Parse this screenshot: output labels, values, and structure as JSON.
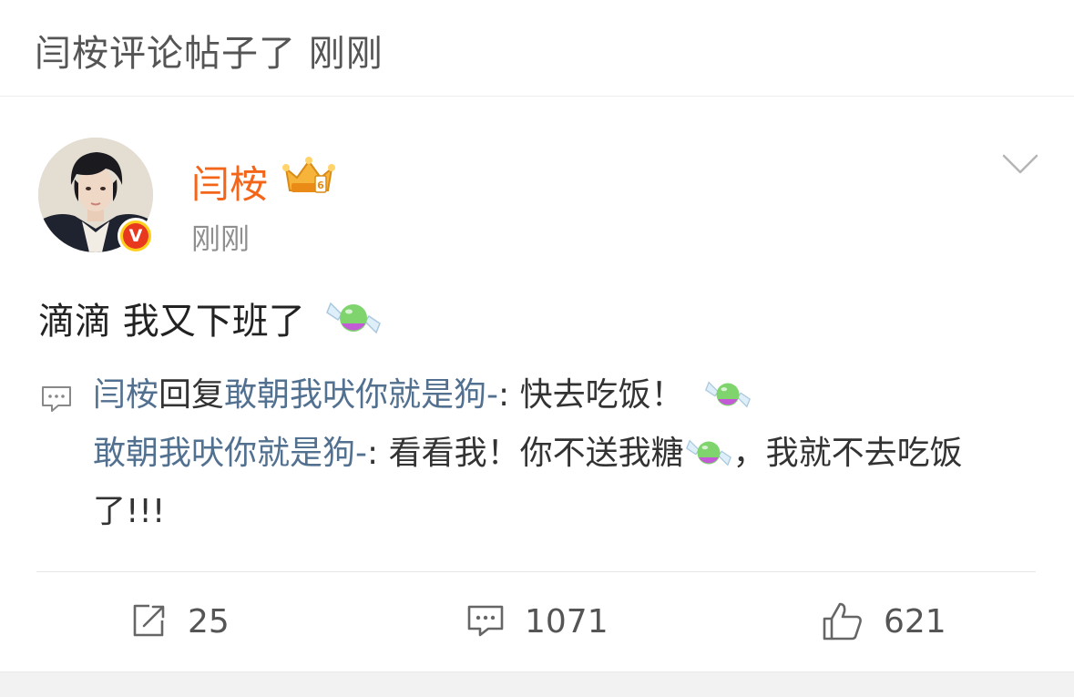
{
  "header": {
    "title": "闫桉评论帖子了 刚刚"
  },
  "post": {
    "author": {
      "name": "闫桉",
      "verified_badge": "V"
    },
    "time": "刚刚",
    "text": "滴滴 我又下班了",
    "text_emoji": "candy-emoji"
  },
  "reply": {
    "prefix_user": "闫桉",
    "reply_verb": "回复",
    "target_user": "敢朝我吠你就是狗-",
    "colon": ": ",
    "message": "快去吃饭！",
    "quoted": {
      "user": "敢朝我吠你就是狗-",
      "colon": ": ",
      "message_part1": "看看我！你不送我糖",
      "message_part2": "，我就不去吃饭了!!!"
    }
  },
  "actions": {
    "repost_count": "25",
    "comment_count": "1071",
    "like_count": "621"
  },
  "colors": {
    "author": "#f3661a",
    "link": "#52708f",
    "muted": "#8f8f8f"
  }
}
